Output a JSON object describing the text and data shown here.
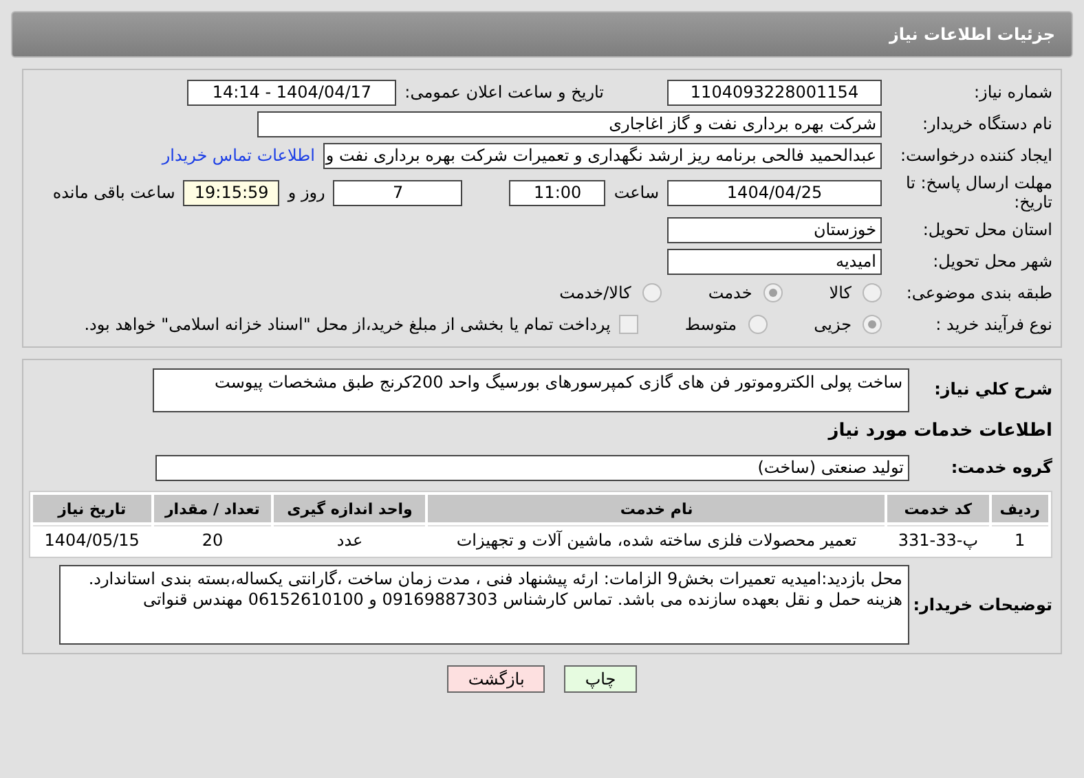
{
  "title": "جزئیات اطلاعات نیاز",
  "need_number": {
    "label": "شماره نیاز:",
    "value": "1104093228001154"
  },
  "announce": {
    "label": "تاریخ و ساعت اعلان عمومی:",
    "value": "1404/04/17 - 14:14"
  },
  "buyer": {
    "label": "نام دستگاه خریدار:",
    "value": "شرکت بهره برداری نفت و گاز اغاجاری"
  },
  "creator": {
    "label": "ایجاد کننده درخواست:",
    "value": "عبدالحمید فالحی برنامه ریز ارشد نگهداری و تعمیرات شرکت بهره برداری نفت و",
    "link": "اطلاعات تماس خریدار"
  },
  "deadline": {
    "label": "مهلت ارسال پاسخ: تا تاریخ:",
    "date": "1404/04/25",
    "time_label": "ساعت",
    "time": "11:00",
    "days": "7",
    "days_label": "روز و",
    "remaining": "19:15:59",
    "remaining_label": "ساعت باقی مانده"
  },
  "province": {
    "label": "استان محل تحویل:",
    "value": "خوزستان"
  },
  "city": {
    "label": "شهر محل تحویل:",
    "value": "امیدیه"
  },
  "category": {
    "label": "طبقه بندی موضوعی:",
    "options": [
      {
        "label": "کالا",
        "selected": false
      },
      {
        "label": "خدمت",
        "selected": true
      },
      {
        "label": "کالا/خدمت",
        "selected": false
      }
    ]
  },
  "purchase_type": {
    "label": "نوع فرآیند خرید :",
    "options": [
      {
        "label": "جزیی",
        "selected": true
      },
      {
        "label": "متوسط",
        "selected": false
      }
    ],
    "payment": {
      "label": "پرداخت تمام یا بخشی از مبلغ خرید،از محل \"اسناد خزانه اسلامی\" خواهد بود.",
      "checked": false
    }
  },
  "summary": {
    "label": "شرح کلي نياز:",
    "value": "ساخت پولی الکتروموتور فن های گازی کمپرسورهای بورسیگ واحد 200کرنج طبق مشخصات پیوست"
  },
  "services_heading": "اطلاعات خدمات مورد نیاز",
  "service_group": {
    "label": "گروه خدمت:",
    "value": "تولید صنعتی (ساخت)"
  },
  "table": {
    "columns": [
      "ردیف",
      "کد خدمت",
      "نام خدمت",
      "واحد اندازه گیری",
      "تعداد / مقدار",
      "تاریخ نیاز"
    ],
    "rows": [
      [
        "1",
        "پ-33-331",
        "تعمیر محصولات فلزی ساخته شده، ماشین آلات و تجهیزات",
        "عدد",
        "20",
        "1404/05/15"
      ]
    ]
  },
  "notes": {
    "label": "توضیحات خریدار:",
    "value": "محل بازدید:امیدیه تعمیرات بخش9 الزامات: ارئه پیشنهاد فنی ، مدت زمان ساخت ،گارانتی یکساله،بسته بندی استاندارد. هزینه حمل و نقل بعهده سازنده می باشد. تماس کارشناس 09169887303 و 06152610100 مهندس قنواتی"
  },
  "buttons": [
    {
      "label": "چاپ",
      "kind": "print"
    },
    {
      "label": "بازگشت",
      "kind": "back"
    }
  ]
}
